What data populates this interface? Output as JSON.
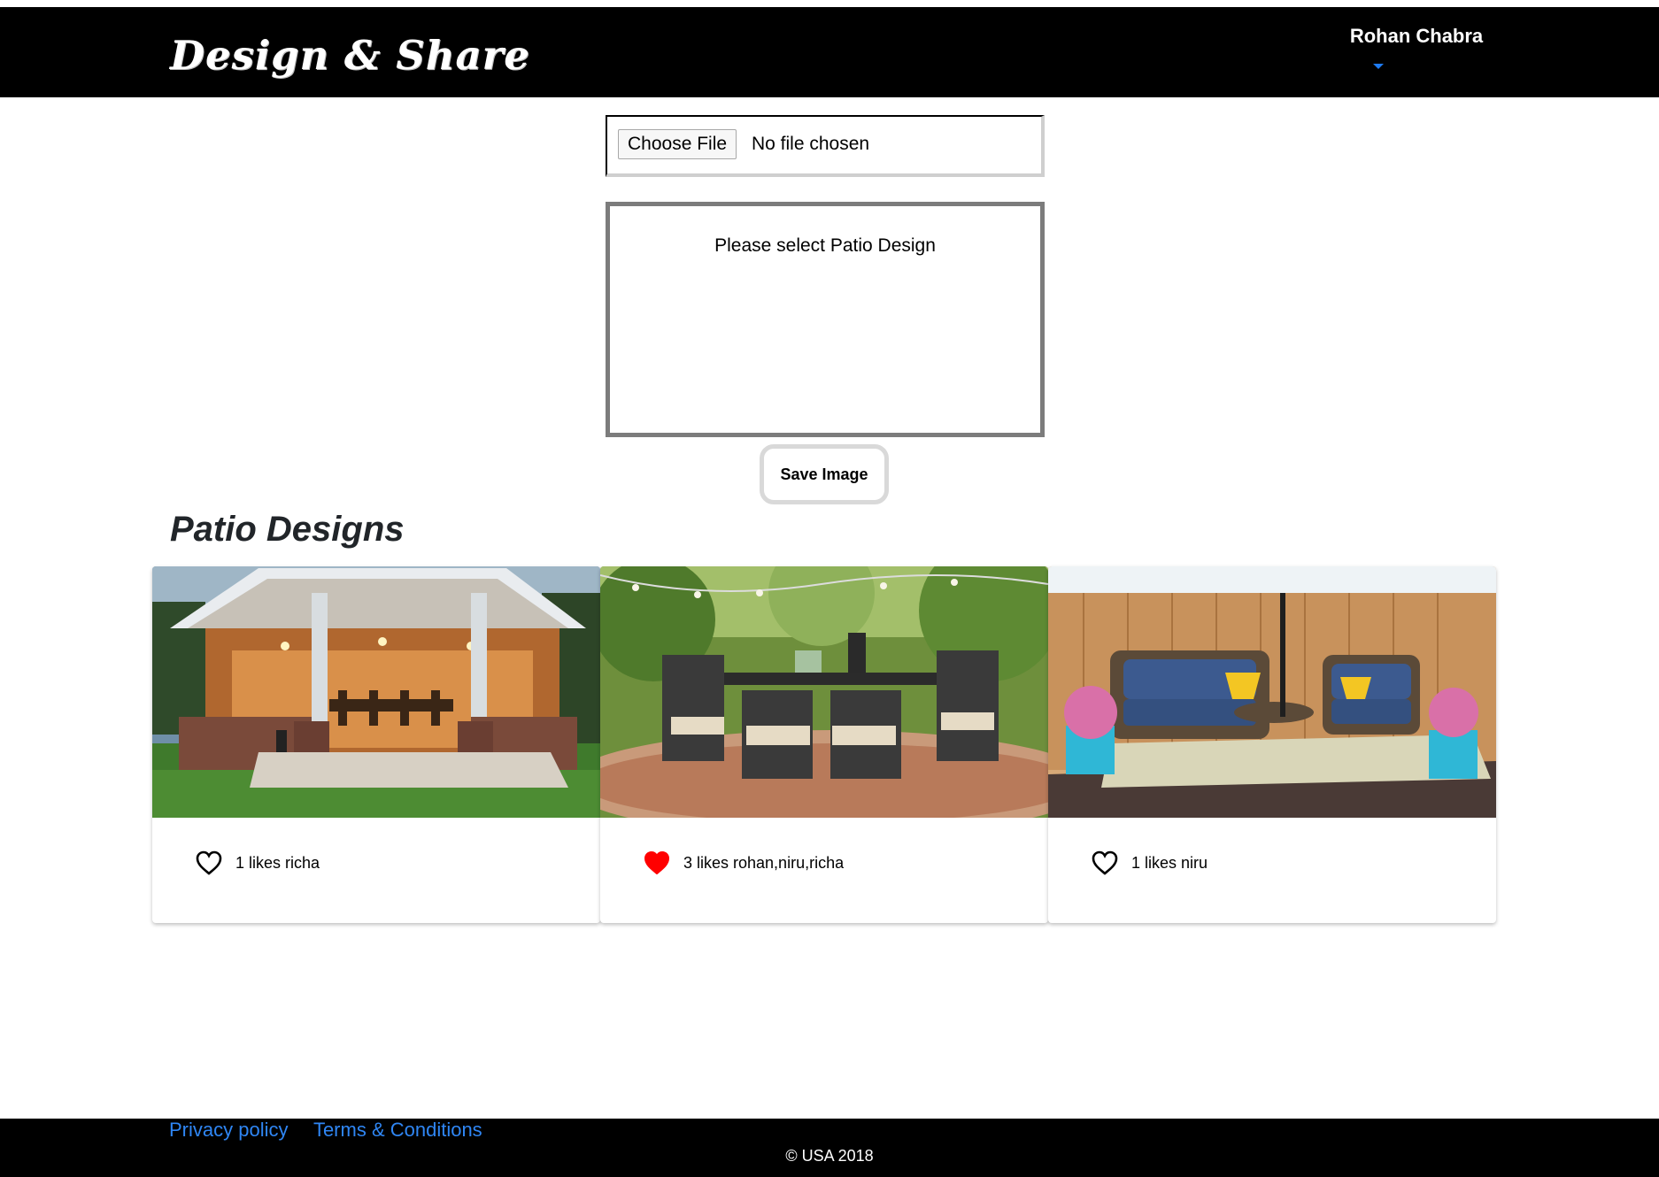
{
  "header": {
    "brand": "Design & Share",
    "user_name": "Rohan Chabra"
  },
  "upload": {
    "choose_label": "Choose File",
    "status": "No file chosen",
    "preview_text": "Please select Patio Design",
    "save_label": "Save Image"
  },
  "gallery": {
    "title": "Patio Designs",
    "cards": [
      {
        "likes_text": "1 likes richa",
        "liked": false
      },
      {
        "likes_text": "3 likes rohan,niru,richa",
        "liked": true
      },
      {
        "likes_text": "1 likes niru",
        "liked": false
      }
    ]
  },
  "footer": {
    "privacy": "Privacy policy",
    "terms": "Terms & Conditions",
    "copyright": "© USA 2018"
  },
  "colors": {
    "navbar": "#000000",
    "link": "#2f86f4",
    "liked_heart": "#ff0000",
    "caret": "#1e7bf2"
  }
}
